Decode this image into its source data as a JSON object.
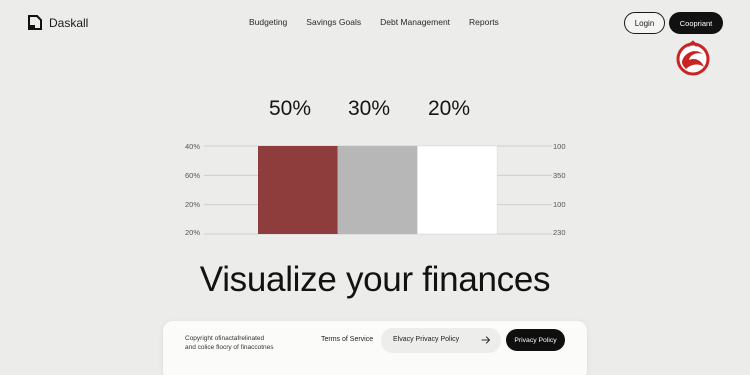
{
  "nav": {
    "brand": "Daskall",
    "links": [
      "Budgeting",
      "Savings Goals",
      "Debt Management",
      "Reports"
    ],
    "login_label": "Login",
    "cta_label": "Coopriant"
  },
  "chart_data": {
    "type": "bar",
    "categories": [
      "50%",
      "30%",
      "20%"
    ],
    "values": [
      50,
      30,
      20
    ],
    "value_labels": [
      "50%",
      "30%",
      "20%"
    ],
    "left_ticks": [
      "40%",
      "60%",
      "20%",
      "20%"
    ],
    "right_ticks": [
      "100",
      "350",
      "100",
      "230"
    ],
    "colors": [
      "#8f3c3c",
      "#b7b7b7",
      "#ffffff"
    ],
    "grid": true,
    "legend": "none"
  },
  "hero": {
    "title": "Visualize your finances"
  },
  "footer": {
    "copyright_line1": "Copyright ofinactafrelinated",
    "copyright_line2": "and colice flocry of finaccotnes",
    "terms_label": "Terms of Service",
    "input_text": "Elvacy Privacy Policy",
    "button_label": "Privacy Policy"
  },
  "icons": {
    "brand": "daskall-logo-icon",
    "emblem": "red-swirl-emblem-icon",
    "arrow": "arrow-right-icon"
  }
}
